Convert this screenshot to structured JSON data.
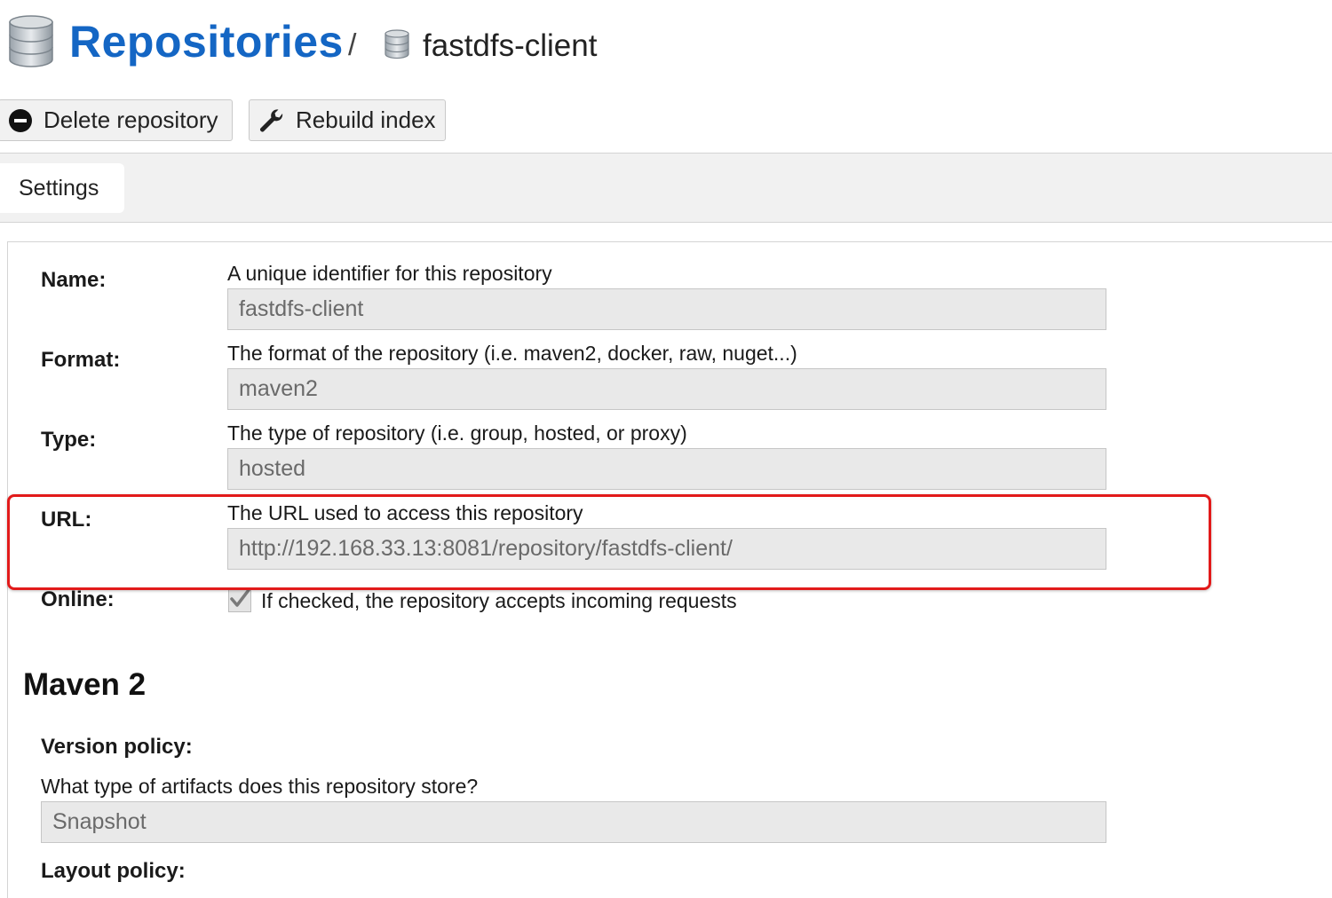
{
  "header": {
    "title": "Repositories",
    "separator": "/",
    "current": "fastdfs-client"
  },
  "toolbar": {
    "delete_label": "Delete repository",
    "rebuild_label": "Rebuild index"
  },
  "tabs": [
    {
      "label": "Settings",
      "active": true
    }
  ],
  "form": {
    "name": {
      "label": "Name:",
      "help": "A unique identifier for this repository",
      "value": "fastdfs-client"
    },
    "format": {
      "label": "Format:",
      "help": "The format of the repository (i.e. maven2, docker, raw, nuget...)",
      "value": "maven2"
    },
    "type": {
      "label": "Type:",
      "help": "The type of repository (i.e. group, hosted, or proxy)",
      "value": "hosted"
    },
    "url": {
      "label": "URL:",
      "help": "The URL used to access this repository",
      "value": "http://192.168.33.13:8081/repository/fastdfs-client/"
    },
    "online": {
      "label": "Online:",
      "checked": true,
      "help": "If checked, the repository accepts incoming requests"
    }
  },
  "maven": {
    "section_title": "Maven 2",
    "version_policy": {
      "label": "Version policy:",
      "help": "What type of artifacts does this repository store?",
      "value": "Snapshot"
    },
    "layout_policy": {
      "label": "Layout policy:"
    }
  },
  "colors": {
    "title": "#1466c4",
    "highlight": "#e21a1a",
    "field_bg": "#e9e9e9"
  },
  "icons": {
    "header": "database-icon",
    "delete": "minus-circle-icon",
    "rebuild": "wrench-icon",
    "check": "checkmark-icon"
  }
}
